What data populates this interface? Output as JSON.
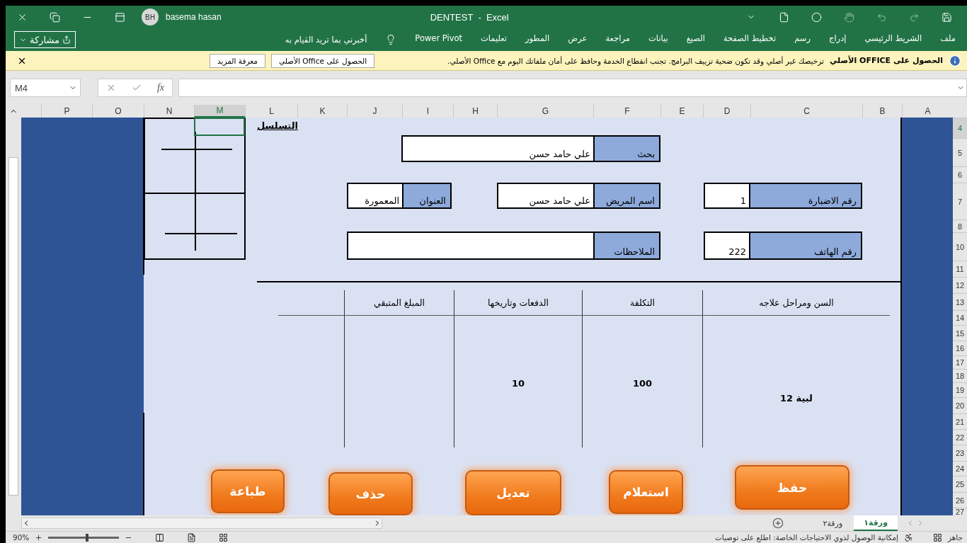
{
  "title_bar": {
    "user_initials": "BH",
    "user_name": "basema hasan",
    "title": "DENTEST  -  Excel"
  },
  "ribbon": {
    "tabs": [
      {
        "label": "ملف",
        "selected": false
      },
      {
        "label": "الشريط الرئيسي",
        "selected": false
      },
      {
        "label": "إدراج",
        "selected": false
      },
      {
        "label": "رسم",
        "selected": false
      },
      {
        "label": "تخطيط الصفحة",
        "selected": false
      },
      {
        "label": "الصيغ",
        "selected": false
      },
      {
        "label": "بيانات",
        "selected": false
      },
      {
        "label": "مراجعة",
        "selected": false
      },
      {
        "label": "عرض",
        "selected": false
      },
      {
        "label": "المطور",
        "selected": false
      },
      {
        "label": "تعليمات",
        "selected": false
      },
      {
        "label": "Power Pivot",
        "selected": false
      }
    ],
    "tell_me": "أخبرني بما تريد القيام به",
    "share": "مشاركة"
  },
  "notice": {
    "heading": "الحصول على OFFICE الأصلي",
    "message": "ترخيصك غير أصلي وقد تكون ضحية تزييف البرامج. تجنب انقطاع الخدمة وحافظ على أمان ملفاتك اليوم مع Office الأصلي.",
    "buttons": [
      "الحصول على Office الأصلي",
      "معرفة المزيد"
    ]
  },
  "formula_bar": {
    "name_box": "M4",
    "fx": "fx"
  },
  "columns": [
    {
      "label": "A",
      "selected": false
    },
    {
      "label": "B",
      "selected": false
    },
    {
      "label": "C",
      "selected": false
    },
    {
      "label": "D",
      "selected": false
    },
    {
      "label": "E",
      "selected": false
    },
    {
      "label": "F",
      "selected": false
    },
    {
      "label": "G",
      "selected": false
    },
    {
      "label": "H",
      "selected": false
    },
    {
      "label": "I",
      "selected": false
    },
    {
      "label": "J",
      "selected": false
    },
    {
      "label": "K",
      "selected": false
    },
    {
      "label": "L",
      "selected": false
    },
    {
      "label": "M",
      "selected": true
    },
    {
      "label": "N",
      "selected": false
    },
    {
      "label": "O",
      "selected": false
    },
    {
      "label": "P",
      "selected": false
    }
  ],
  "rows": [
    {
      "label": "4",
      "selected": true
    },
    {
      "label": "5",
      "selected": false
    },
    {
      "label": "6",
      "selected": false
    },
    {
      "label": "7",
      "selected": false
    },
    {
      "label": "8",
      "selected": false
    },
    {
      "label": "10",
      "selected": false
    },
    {
      "label": "11",
      "selected": false
    },
    {
      "label": "12",
      "selected": false
    },
    {
      "label": "13",
      "selected": false
    },
    {
      "label": "14",
      "selected": false
    },
    {
      "label": "15",
      "selected": false
    },
    {
      "label": "16",
      "selected": false
    },
    {
      "label": "17",
      "selected": false
    },
    {
      "label": "18",
      "selected": false
    },
    {
      "label": "19",
      "selected": false
    },
    {
      "label": "20",
      "selected": false
    },
    {
      "label": "21",
      "selected": false
    },
    {
      "label": "22",
      "selected": false
    },
    {
      "label": "23",
      "selected": false
    },
    {
      "label": "24",
      "selected": false
    },
    {
      "label": "25",
      "selected": false
    },
    {
      "label": "26",
      "selected": false
    },
    {
      "label": "27",
      "selected": false
    }
  ],
  "form": {
    "title": "التسلسل",
    "fields": [
      {
        "label": "بحث",
        "value": "علي حامد حسن"
      },
      {
        "label": "رقم الاضبارة",
        "value": "1"
      },
      {
        "label": "اسم المريض",
        "value": "علي حامد حسن"
      },
      {
        "label": "العنوان",
        "value": "المعمورة"
      },
      {
        "label": "رقم الهاتف",
        "value": "222"
      },
      {
        "label": "الملاحظات"
      }
    ],
    "table": {
      "columns": [
        "السن ومراحل علاجه",
        "التكلفة",
        "الدفعات وتاريخها",
        "المبلغ المتبقي"
      ],
      "rows": [
        [
          "لبية 12",
          "100",
          "10"
        ]
      ]
    },
    "buttons": [
      "حفظ",
      "استعلام",
      "تعديل",
      "حذف",
      "طباعة"
    ]
  },
  "sheet_tabs": [
    {
      "label": "ورقة١",
      "selected": true
    },
    {
      "label": "ورقة٢",
      "selected": false
    }
  ],
  "status_bar": {
    "state": "جاهز",
    "message": "إمكانية الوصول لذوي الاحتياجات الخاصة: اطلع على توصيات",
    "zoom": "90%",
    "zoom_slider": {
      "level": 0.55
    }
  }
}
